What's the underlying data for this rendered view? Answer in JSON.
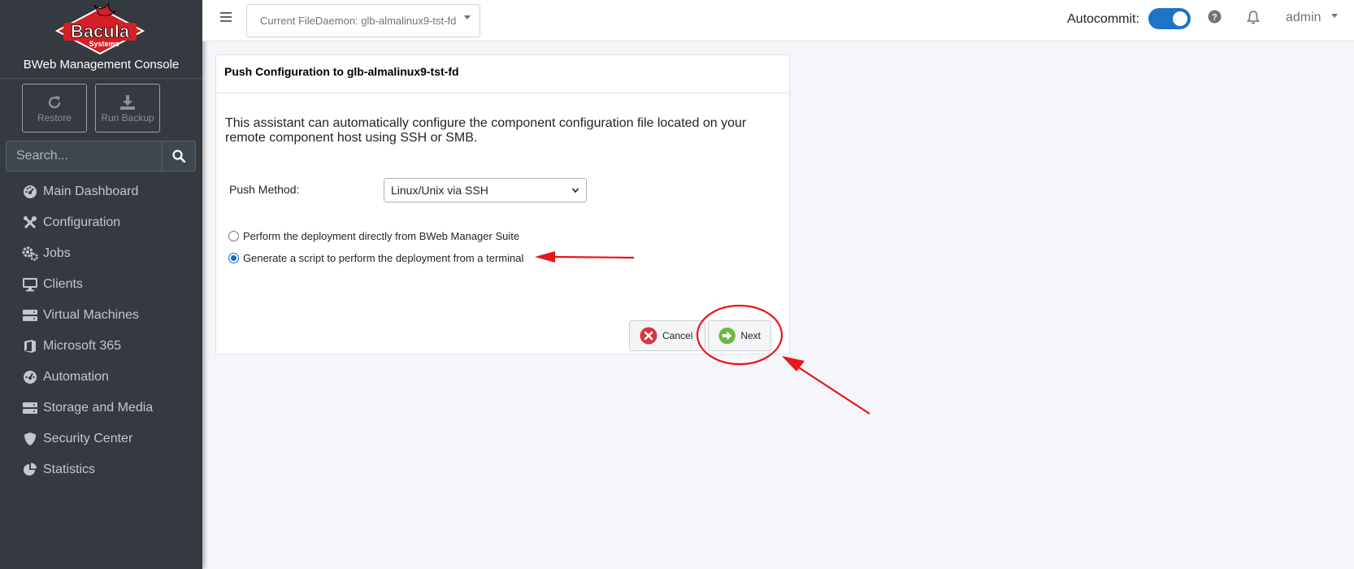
{
  "sidebar": {
    "brand_name": "BWeb Management Console",
    "logo_text": "Bacula",
    "logo_subtext": "Systems",
    "actions": [
      {
        "label": "Restore",
        "icon": "restore-icon"
      },
      {
        "label": "Run Backup",
        "icon": "download-icon"
      }
    ],
    "search_placeholder": "Search...",
    "nav": [
      {
        "label": "Main Dashboard",
        "icon": "dashboard-icon"
      },
      {
        "label": "Configuration",
        "icon": "tools-icon"
      },
      {
        "label": "Jobs",
        "icon": "cogs-icon"
      },
      {
        "label": "Clients",
        "icon": "desktop-icon"
      },
      {
        "label": "Virtual Machines",
        "icon": "server-icon"
      },
      {
        "label": "Microsoft 365",
        "icon": "office-icon"
      },
      {
        "label": "Automation",
        "icon": "gauge-icon"
      },
      {
        "label": "Storage and Media",
        "icon": "storage-icon"
      },
      {
        "label": "Security Center",
        "icon": "shield-icon"
      },
      {
        "label": "Statistics",
        "icon": "pie-chart-icon"
      }
    ]
  },
  "topbar": {
    "filedaemon_label": "Current FileDaemon: glb-almalinux9-tst-fd",
    "autocommit_label": "Autocommit:",
    "autocommit_on": true,
    "user": "admin"
  },
  "card": {
    "title": "Push Configuration to glb-almalinux9-tst-fd",
    "intro": "This assistant can automatically configure the component configuration file located on your remote component host using SSH or SMB.",
    "push_method_label": "Push Method:",
    "push_method_value": "Linux/Unix via SSH",
    "options": [
      {
        "label": "Perform the deployment directly from BWeb Manager Suite",
        "checked": false
      },
      {
        "label": "Generate a script to perform the deployment from a terminal",
        "checked": true
      }
    ],
    "cancel_label": "Cancel",
    "next_label": "Next"
  },
  "colors": {
    "sidebar_bg": "#343a40",
    "accent": "#1c74c4",
    "annotation": "#e8161b"
  }
}
